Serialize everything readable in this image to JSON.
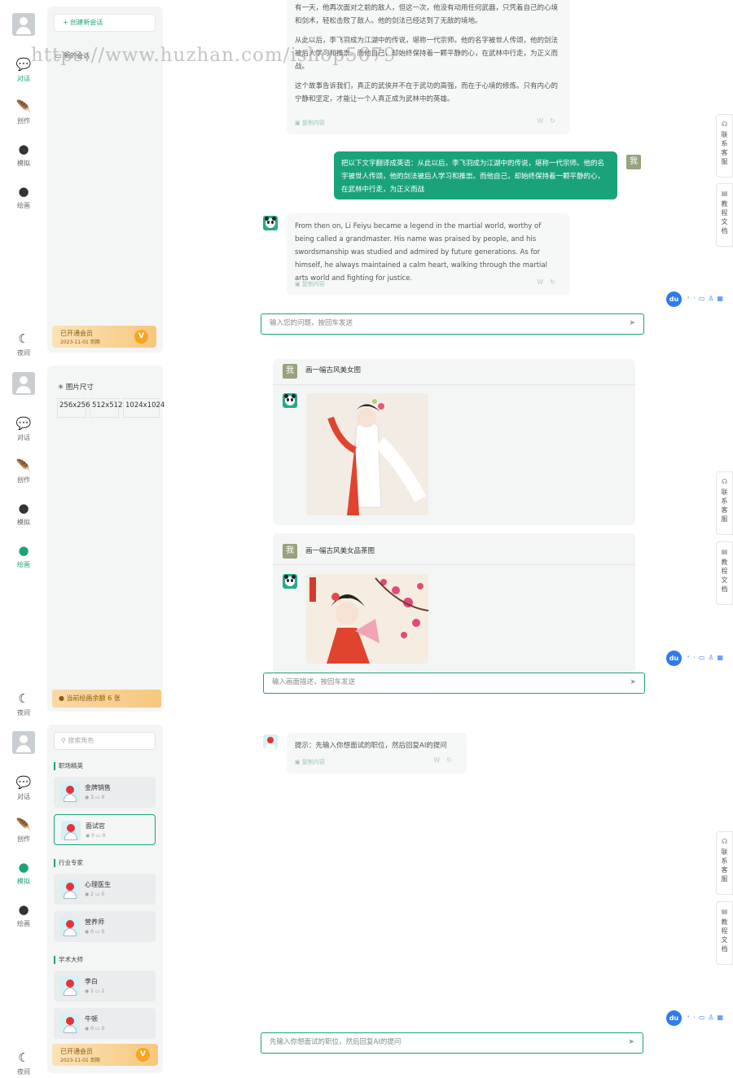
{
  "rail": {
    "chat": "对话",
    "create": "创作",
    "roleplay": "模拟",
    "draw": "绘画",
    "night": "夜间"
  },
  "watermark": "https://www.huzhan.com/ishop5679",
  "panel1": {
    "new_chat": "+ 创建新会话",
    "conversation": "新的会话",
    "ai_text_top": "有一天，他再次面对之前的敌人，但这一次，他没有动用任何武器，只凭着自己的心境和剑术，轻松击败了敌人。他的剑法已经达到了无敌的境地。",
    "ai_text_p2": "从此以后，李飞羽成为江湖中的传说，堪称一代宗师。他的名字被世人传颂，他的剑法被后人学习和推崇。而他自己，却始终保持着一颗平静的心，在武林中行走，为正义而战。",
    "ai_text_p3": "这个故事告诉我们，真正的武侠并不在于武功的高强，而在于心境的修炼。只有内心的宁静和坚定，才能让一个人真正成为武林中的英雄。",
    "copy": "复制内容",
    "user_msg": "把以下文字翻译成英语：从此以后，李飞羽成为江湖中的传说，堪称一代宗师。他的名字被世人传颂，他的剑法被后人学习和推崇。而他自己，却始终保持着一颗平静的心，在武林中行走，为正义而战",
    "me": "我",
    "ai_en": "From then on, Li Feiyu became a legend in the martial world, worthy of being called a grandmaster. His name was praised by people, and his swordsmanship was studied and admired by future generations. As for himself, he always maintained a calm heart, walking through the martial arts world and fighting for justice.",
    "input_placeholder": "输入您的问题，按回车发送",
    "member_title": "已开通会员",
    "member_expire": "2023-11-01 到期",
    "vip": "V",
    "tab_service": "联系客服",
    "tab_docs": "教程文档",
    "du": "du"
  },
  "panel2": {
    "size_title": "图片尺寸",
    "sizes": [
      "256x256",
      "512x512",
      "1024x1024"
    ],
    "prompt1": "画一幅古风美女图",
    "prompt2": "画一幅古风美女品茶图",
    "me": "我",
    "credits": "当前绘画余额 6 张",
    "input_placeholder": "输入画面描述，按回车发送",
    "tab_service": "联系客服",
    "tab_docs": "教程文档",
    "du": "du"
  },
  "panel3": {
    "search_placeholder": "搜索角色",
    "categories": [
      "职场精英",
      "行业专家",
      "学术大师"
    ],
    "roles": [
      {
        "name": "金牌销售",
        "views": "3",
        "chats": "0"
      },
      {
        "name": "面试官",
        "views": "0",
        "chats": "0"
      },
      {
        "name": "心理医生",
        "views": "2",
        "chats": "0"
      },
      {
        "name": "营养师",
        "views": "0",
        "chats": "0"
      },
      {
        "name": "李白",
        "views": "1",
        "chats": "2"
      },
      {
        "name": "牛顿",
        "views": "0",
        "chats": "0"
      }
    ],
    "hint": "提示：先输入你想面试的职位，然后回复AI的提问",
    "copy": "复制内容",
    "input_placeholder": "先输入你想面试的职位，然后回复AI的提问",
    "member_title": "已开通会员",
    "member_expire": "2023-11-01 到期",
    "vip": "V",
    "tab_service": "联系客服",
    "tab_docs": "教程文档",
    "du": "du"
  },
  "colors": {
    "accent": "#1aa37a",
    "gold": "#f5a623",
    "du_blue": "#2f7bea"
  }
}
